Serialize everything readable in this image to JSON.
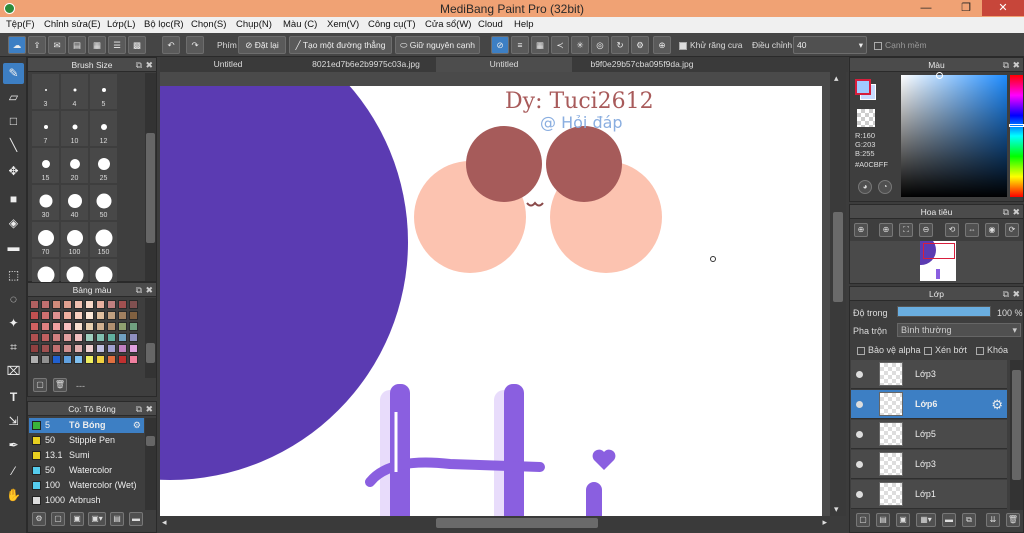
{
  "window": {
    "title": "MediBang Paint Pro (32bit)",
    "minimize": "—",
    "maximize": "❐",
    "close": "✕"
  },
  "menu": [
    "Tệp(F)",
    "Chỉnh sửa(E)",
    "Lớp(L)",
    "Bộ lọc(R)",
    "Chọn(S)",
    "Chụp(N)",
    "Màu (C)",
    "Xem(V)",
    "Công cụ(T)",
    "Cửa sổ(W)",
    "Cloud",
    "Help"
  ],
  "toolbar": {
    "snap_label": "Phím",
    "reset_label": "Đặt lại",
    "straight_line_label": "Tạo một đường thẳng",
    "keep_edge_label": "Giữ nguyên cạnh",
    "antialias_label": "Khử răng cưa",
    "adjust_label": "Điều chỉnh",
    "adjust_value": "40",
    "smooth_label": "Cạnh mềm"
  },
  "tabs": [
    "Untitled",
    "8021ed7b6e2b9975c03a.jpg",
    "Untitled",
    "b9f0e29b57cba095f9da.jpg"
  ],
  "active_tab": 2,
  "brush_size": {
    "title": "Brush Size",
    "sizes": [
      "3",
      "4",
      "5",
      "7",
      "10",
      "12",
      "15",
      "20",
      "25",
      "30",
      "40",
      "50",
      "70",
      "100",
      "150",
      "200",
      "300",
      "400"
    ]
  },
  "palette": {
    "title": "Bảng màu",
    "colors": [
      "#b06060",
      "#c07070",
      "#d08a7a",
      "#e0a090",
      "#f0c0b0",
      "#f8d8c8",
      "#e8b0a0",
      "#c08080",
      "#a05050",
      "#805050",
      "#c05050",
      "#d07070",
      "#e09090",
      "#f0b0a0",
      "#f8d0c0",
      "#fce8d8",
      "#e0c0a0",
      "#c0a080",
      "#a08060",
      "#806040",
      "#d06060",
      "#e08080",
      "#f0a0a0",
      "#f8c0c0",
      "#f8e0d0",
      "#e8d0b0",
      "#d0b090",
      "#b09070",
      "#90a070",
      "#70a080",
      "#b05050",
      "#c06060",
      "#d08080",
      "#e0a0a0",
      "#f0c0c0",
      "#a0d0c0",
      "#80c0b0",
      "#60b0a0",
      "#70a0c0",
      "#9090c0",
      "#904040",
      "#a05050",
      "#c07070",
      "#d09090",
      "#e0b0b0",
      "#f0d0d0",
      "#c0c0e0",
      "#a0a0d0",
      "#c080c0",
      "#e0a0e0",
      "#b0b0b0",
      "#909090",
      "#2060d0",
      "#60a0e0",
      "#80c0f0",
      "#f0f060",
      "#f0d040",
      "#e07040",
      "#c03030",
      "#f080a0"
    ],
    "count": "---"
  },
  "brush_panel": {
    "title": "Cọ: Tô Bóng",
    "items": [
      {
        "size": "5",
        "name": "Tô Bóng",
        "color": "#3ab33a"
      },
      {
        "size": "50",
        "name": "Stipple Pen",
        "color": "#e8d020"
      },
      {
        "size": "13.1",
        "name": "Sumi",
        "color": "#e8d020"
      },
      {
        "size": "50",
        "name": "Watercolor",
        "color": "#55ccee"
      },
      {
        "size": "100",
        "name": "Watercolor (Wet)",
        "color": "#55ccee"
      },
      {
        "size": "1000",
        "name": "Arbrush",
        "color": "#dddddd"
      }
    ]
  },
  "canvas": {
    "signature": "Dy: Tuci2612",
    "credit": "@ Hỏi đáp",
    "letters": "Hi"
  },
  "color_panel": {
    "title": "Màu",
    "r_label": "R:160",
    "g_label": "G:203",
    "b_label": "B:255",
    "hex": "#A0CBFF",
    "primary": "#A0CBFF",
    "secondary": "#d81e3c"
  },
  "navigator": {
    "title": "Hoa tiêu"
  },
  "layers": {
    "title": "Lớp",
    "opacity_label": "Độ trong",
    "opacity_value": "100 %",
    "opacity_fraction": 1.0,
    "blend_label": "Pha trộn",
    "blend_value": "Bình thường",
    "protect_alpha": "Bảo vệ alpha",
    "clipping": "Xén bớt",
    "lock": "Khóa",
    "items": [
      {
        "name": "Lớp3",
        "selected": false
      },
      {
        "name": "Lớp6",
        "selected": true
      },
      {
        "name": "Lớp5",
        "selected": false
      },
      {
        "name": "Lớp3",
        "selected": false
      },
      {
        "name": "Lớp1",
        "selected": false
      }
    ]
  }
}
